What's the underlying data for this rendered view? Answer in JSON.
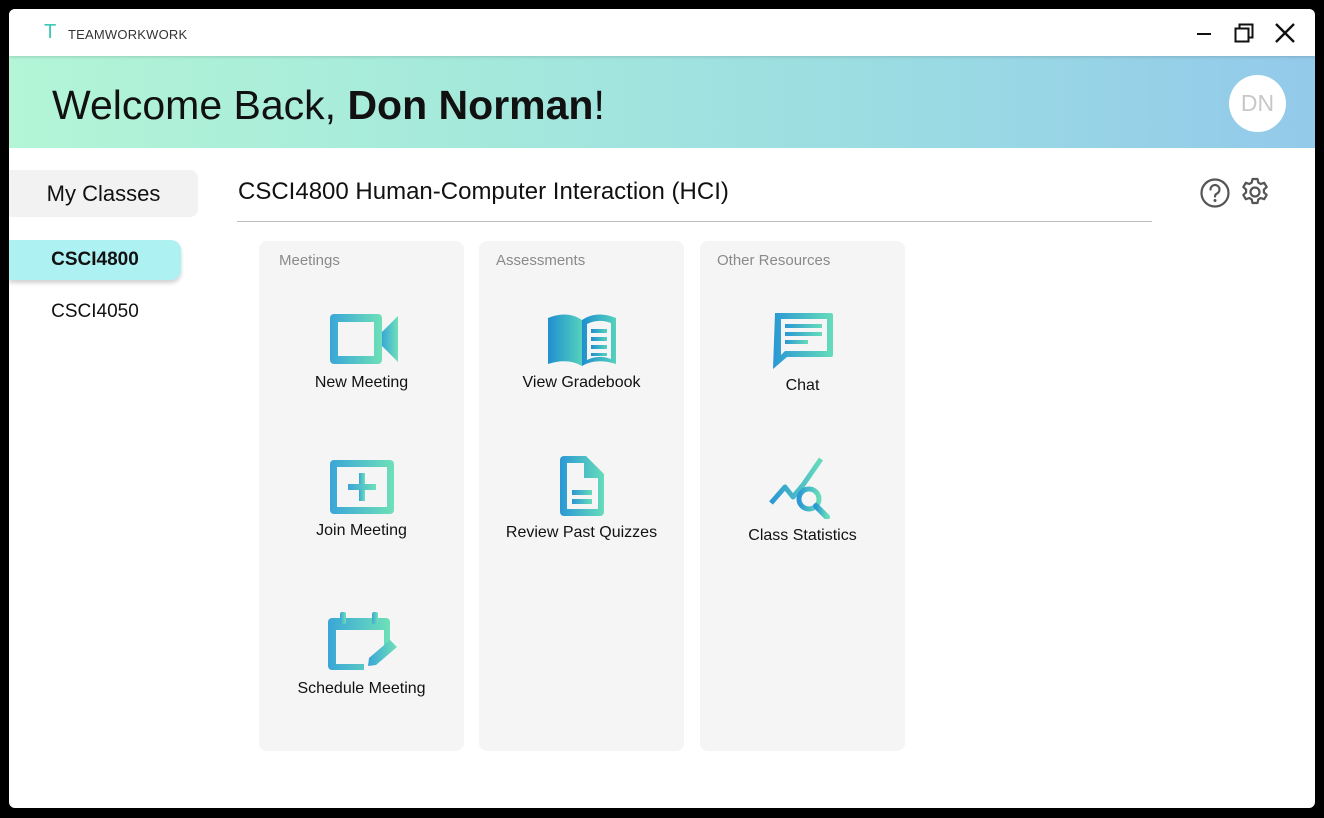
{
  "titlebar": {
    "logo_letter": "T",
    "app_name": "TEAMWORKWORK"
  },
  "banner": {
    "greeting": "Welcome Back, ",
    "user_name": "Don Norman",
    "punctuation": "!",
    "avatar_initials": "DN"
  },
  "sidebar": {
    "heading": "My Classes",
    "classes": [
      {
        "label": "CSCI4800",
        "selected": true
      },
      {
        "label": "CSCI4050",
        "selected": false
      }
    ]
  },
  "main": {
    "course_title": "CSCI4800 Human-Computer Interaction (HCI)",
    "panels": [
      {
        "title": "Meetings",
        "tiles": [
          {
            "label": "New Meeting",
            "icon": "video-camera-icon"
          },
          {
            "label": "Join Meeting",
            "icon": "plus-square-icon"
          },
          {
            "label": "Schedule Meeting",
            "icon": "calendar-edit-icon"
          }
        ]
      },
      {
        "title": "Assessments",
        "tiles": [
          {
            "label": "View Gradebook",
            "icon": "open-book-icon"
          },
          {
            "label": "Review Past Quizzes",
            "icon": "document-icon"
          }
        ]
      },
      {
        "title": "Other Resources",
        "tiles": [
          {
            "label": "Chat",
            "icon": "chat-bubble-icon"
          },
          {
            "label": "Class Statistics",
            "icon": "chart-search-icon"
          }
        ]
      }
    ]
  },
  "colors": {
    "accent": "#3fc7b4",
    "icon_gradient_start": "#3aa6d8",
    "icon_gradient_end": "#6ee0b8",
    "active_class_bg": "#aef1f3"
  }
}
